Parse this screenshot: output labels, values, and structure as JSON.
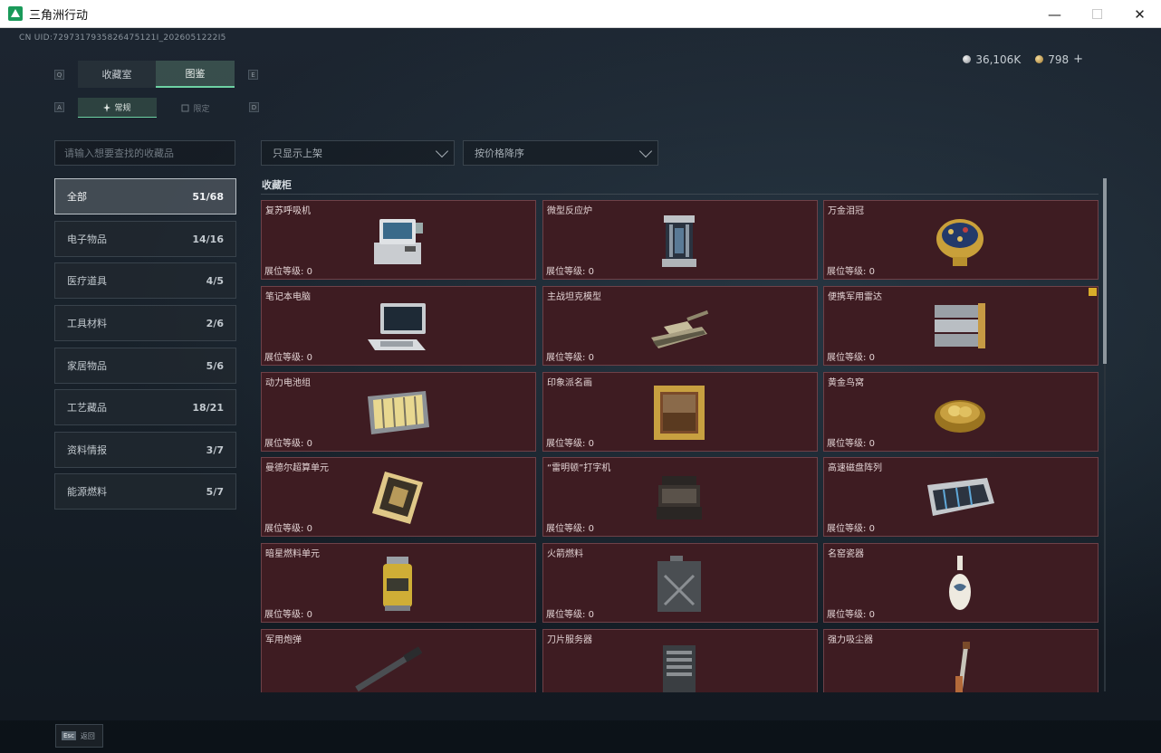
{
  "window": {
    "title": "三角洲行动",
    "minimize": "—",
    "maximize": "☐",
    "close": "✕"
  },
  "uid": "CN UID:7297317935826475121I_2026051222I5",
  "currency": [
    {
      "icon": "silver-coin-icon",
      "value": "36,106K",
      "color": "#b8bcc0"
    },
    {
      "icon": "gold-coin-icon",
      "value": "798",
      "color": "#c9a356"
    }
  ],
  "currency_add": "+",
  "tabs": {
    "main": [
      "收藏室",
      "图鉴"
    ],
    "main_active": "图鉴",
    "sub": [
      "常规",
      "限定"
    ],
    "sub_active": "常规",
    "keys": {
      "q": "Q",
      "e": "E",
      "a": "A",
      "d": "D"
    }
  },
  "search": {
    "placeholder": "请输入想要查找的收藏品"
  },
  "filters": {
    "display": "只显示上架",
    "sort": "按价格降序"
  },
  "categories": [
    {
      "label": "全部",
      "count": "51/68",
      "selected": true
    },
    {
      "label": "电子物品",
      "count": "14/16"
    },
    {
      "label": "医疗道具",
      "count": "4/5"
    },
    {
      "label": "工具材料",
      "count": "2/6"
    },
    {
      "label": "家居物品",
      "count": "5/6"
    },
    {
      "label": "工艺藏品",
      "count": "18/21"
    },
    {
      "label": "资料情报",
      "count": "3/7"
    },
    {
      "label": "能源燃料",
      "count": "5/7"
    }
  ],
  "section_title": "收藏柜",
  "level_prefix": "展位等级:",
  "items": [
    {
      "name": "复苏呼吸机",
      "level": "0",
      "icon": "ventilator-icon"
    },
    {
      "name": "微型反应炉",
      "level": "0",
      "icon": "reactor-icon"
    },
    {
      "name": "万金泪冠",
      "level": "0",
      "icon": "jeweled-egg-icon"
    },
    {
      "name": "笔记本电脑",
      "level": "0",
      "icon": "laptop-icon"
    },
    {
      "name": "主战坦克模型",
      "level": "0",
      "icon": "tank-model-icon"
    },
    {
      "name": "便携军用雷达",
      "level": "0",
      "icon": "radar-icon",
      "badge": true
    },
    {
      "name": "动力电池组",
      "level": "0",
      "icon": "battery-pack-icon"
    },
    {
      "name": "印象派名画",
      "level": "0",
      "icon": "painting-icon"
    },
    {
      "name": "黄金鸟窝",
      "level": "0",
      "icon": "golden-nest-icon"
    },
    {
      "name": "曼德尔超算单元",
      "level": "0",
      "icon": "supercomputer-chip-icon"
    },
    {
      "name": "“雷明顿”打字机",
      "level": "0",
      "icon": "typewriter-icon"
    },
    {
      "name": "高速磁盘阵列",
      "level": "0",
      "icon": "disk-array-icon"
    },
    {
      "name": "暗星燃料单元",
      "level": "0",
      "icon": "fuel-cell-icon"
    },
    {
      "name": "火箭燃料",
      "level": "0",
      "icon": "fuel-jerrycan-icon"
    },
    {
      "name": "名窑瓷器",
      "level": "0",
      "icon": "porcelain-vase-icon"
    },
    {
      "name": "军用炮弹",
      "level": "",
      "icon": "artillery-shell-icon"
    },
    {
      "name": "刀片服务器",
      "level": "",
      "icon": "blade-server-icon"
    },
    {
      "name": "强力吸尘器",
      "level": "",
      "icon": "vacuum-cleaner-icon"
    }
  ],
  "footer": {
    "key": "Esc",
    "label": "返回"
  }
}
